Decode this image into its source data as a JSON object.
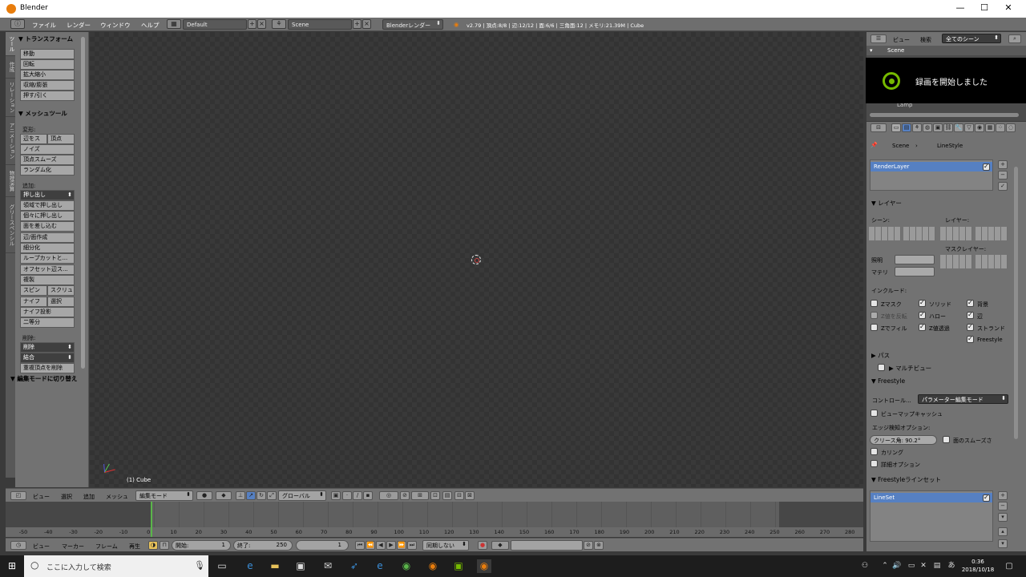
{
  "window": {
    "title": "Blender",
    "minimize": "—",
    "maximize": "☐",
    "close": "✕"
  },
  "topbar": {
    "menus": [
      "ファイル",
      "レンダー",
      "ウィンドウ",
      "ヘルプ"
    ],
    "layout": "Default",
    "scene": "Scene",
    "engine": "Blenderレンダー",
    "stats": "v2.79 | 頂点:8/8 | 辺:12/12 | 面:6/6 | 三角面:12 | メモリ:21.39M | Cube"
  },
  "tabs": [
    "ツール",
    "作成",
    "リレーション",
    "アニメーション",
    "物理演算",
    "グリースペンシル"
  ],
  "toolpanel": {
    "transform_header": "▼ トランスフォーム",
    "transform": [
      "移動",
      "回転",
      "拡大縮小",
      "収縮/膨張",
      "押す/引く"
    ],
    "mesh_header": "▼ メッシュツール",
    "deform_label": "変形:",
    "deform": [
      "辺をス",
      "頂点",
      "ノイズ",
      "頂点スムーズ",
      "ランダム化"
    ],
    "add_label": "追加:",
    "extrude": "押し出し",
    "add": [
      "領域で押し出し",
      "個々に押し出し",
      "面を差し込む",
      "辺/面作成",
      "細分化",
      "ループカットと...",
      "オフセット辺ス...",
      "複製"
    ],
    "spin": [
      "スピン",
      "スクリュ"
    ],
    "knife": [
      "ナイフ",
      "選択"
    ],
    "knife_proj": "ナイフ投影",
    "bisect": "二等分",
    "remove_label": "削除:",
    "delete": "削除",
    "merge": "結合",
    "remove_doubles": "重複頂点を削除",
    "edit_header": "▼ 編集モードに切り替え"
  },
  "viewport": {
    "object_label": "(1) Cube"
  },
  "viewheader": {
    "menus": [
      "ビュー",
      "選択",
      "追加",
      "メッシュ"
    ],
    "mode": "編集モード",
    "orientation": "グローバル"
  },
  "timeline": {
    "ticks": [
      "-50",
      "-40",
      "-30",
      "-20",
      "-10",
      "0",
      "10",
      "20",
      "30",
      "40",
      "50",
      "60",
      "70",
      "80",
      "90",
      "100",
      "110",
      "120",
      "130",
      "140",
      "150",
      "160",
      "170",
      "180",
      "190",
      "200",
      "210",
      "220",
      "230",
      "240",
      "250",
      "260",
      "270",
      "280"
    ],
    "current_frame": "0",
    "start_frame": "1",
    "end_frame": "250"
  },
  "tlheader": {
    "menus": [
      "ビュー",
      "マーカー",
      "フレーム",
      "再生"
    ],
    "start_label": "開始:",
    "start": "1",
    "end_label": "終了:",
    "end": "250",
    "current": "1",
    "sync": "同期しない"
  },
  "outliner": {
    "menus": [
      "ビュー",
      "検索"
    ],
    "filter": "全てのシーン",
    "scene": "Scene",
    "lamp": "Lamp"
  },
  "notification": {
    "text": "録画を開始しました"
  },
  "properties": {
    "breadcrumb_scene": "Scene",
    "breadcrumb_linestyle": "LineStyle",
    "renderlayer": "RenderLayer",
    "layer_header": "▼ レイヤー",
    "scene_label": "シーン:",
    "layer_label": "レイヤー:",
    "mask_label": "マスクレイヤー:",
    "light_label": "照明",
    "material_label": "マテリ",
    "include_label": "インクルード:",
    "include": [
      [
        "Zマスク",
        "ソリッド",
        "背景"
      ],
      [
        "Z値を反転",
        "ハロー",
        "辺"
      ],
      [
        "Zでフィル",
        "Z値透過",
        "ストランド"
      ]
    ],
    "freestyle_check": "Freestyle",
    "pass_header": "▶ パス",
    "multiview_header": "▶ マルチビュー",
    "freestyle_header": "▼ Freestyle",
    "control_label": "コントロール...",
    "control_value": "パラメーター編集モード",
    "viewmap_cache": "ビューマップキャッシュ",
    "edge_label": "エッジ検知オプション:",
    "crease": "クリース角:  90.2°",
    "face_smooth": "面のスムーズさ",
    "culling": "カリング",
    "advanced": "詳細オプション",
    "lineset_header": "▼ Freestyleラインセット",
    "lineset": "LineSet"
  },
  "taskbar": {
    "search": "ここに入力して検索",
    "time": "0:36",
    "date": "2018/10/18"
  }
}
